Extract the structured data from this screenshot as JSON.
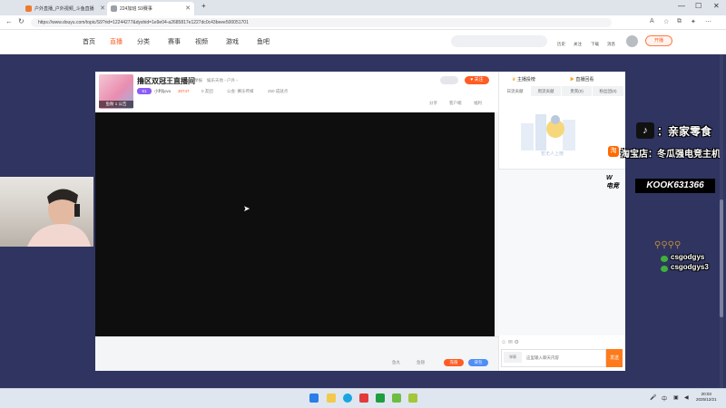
{
  "browser": {
    "tabs": [
      {
        "label": "户外直播_户外视频_斗鱼直播"
      },
      {
        "label": "224加班 S9赛事"
      }
    ],
    "new_tab": "+",
    "url": "https://www.douyu.com/topic/S9?rid=12244277&dyshid=1e9e04-a2685817e1227dc0c43beee500051701",
    "window_controls": {
      "minimize": "—",
      "maximize": "☐",
      "close": "✕"
    }
  },
  "site_nav": {
    "items": [
      "首页",
      "直播",
      "分类",
      "赛事",
      "视频",
      "游戏",
      "鱼吧"
    ],
    "active": "直播",
    "header_links": [
      "历史",
      "关注",
      "下载",
      "消息"
    ],
    "start_live": "开播"
  },
  "room": {
    "title": "撸区双冠王直播间",
    "report": "举报",
    "category": "娱乐天地 › 户外 ›",
    "badge_label": "鱼粉",
    "badge_count": "1",
    "badge_suffix": "公告",
    "level": "51",
    "streamer": "小利ljovo",
    "hot": "30747",
    "fans": "0 友团",
    "notice": "公会: 赛乐传媒",
    "records": "250 成就点",
    "follow_label": "关注",
    "actions": [
      "分享",
      "客户端",
      "福利"
    ]
  },
  "gift_bar": {
    "fish_ball": "鱼丸",
    "fish_fin": "鱼翅",
    "recharge": "充值",
    "backpack": "背包"
  },
  "right_panel": {
    "tab_rank": "主播投榜",
    "tab_review": "直播回看",
    "subtabs": [
      "日流贡献",
      "周流贡献",
      "贵宾(0)",
      "粉丝团(0)"
    ],
    "empty_text": "暂无人上榜",
    "chat_mode": "弹幕",
    "chat_placeholder": "这里输入聊天内容",
    "send_label": "发送"
  },
  "overlays": {
    "tiktok_text": "：亲家零食",
    "taobao_text": "淘宝店：冬瓜强电竞主机",
    "kook_text": "KOOK631366",
    "woo_text": "WOO\n电竞",
    "wechat_ids": [
      "csgodgys",
      "csgodgys3"
    ]
  },
  "taskbar": {
    "time": "20:03",
    "date": "2025/12/21"
  }
}
